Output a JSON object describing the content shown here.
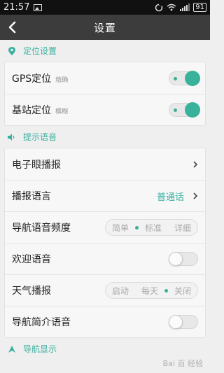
{
  "status_bar": {
    "time": "21:57",
    "battery": "91"
  },
  "header": {
    "title": "设置"
  },
  "sections": {
    "location": {
      "title": "定位设置",
      "gps": {
        "label": "GPS定位",
        "sub": "精确"
      },
      "base": {
        "label": "基站定位",
        "sub": "模糊"
      }
    },
    "voice": {
      "title": "提示语音",
      "e_eye": {
        "label": "电子眼播报"
      },
      "lang": {
        "label": "播报语言",
        "value": "普通话"
      },
      "freq": {
        "label": "导航语音频度",
        "options": [
          "简单",
          "标准",
          "详细"
        ],
        "selected": "标准"
      },
      "welcome": {
        "label": "欢迎语音"
      },
      "weather": {
        "label": "天气播报",
        "options": [
          "启动",
          "每天",
          "关闭"
        ],
        "selected": "关闭"
      },
      "intro": {
        "label": "导航简介语音"
      }
    },
    "display": {
      "title": "导航显示"
    }
  },
  "watermark": "Bai 百 经验",
  "colors": {
    "accent": "#39b29b",
    "topbar": "#3c3c3c"
  }
}
